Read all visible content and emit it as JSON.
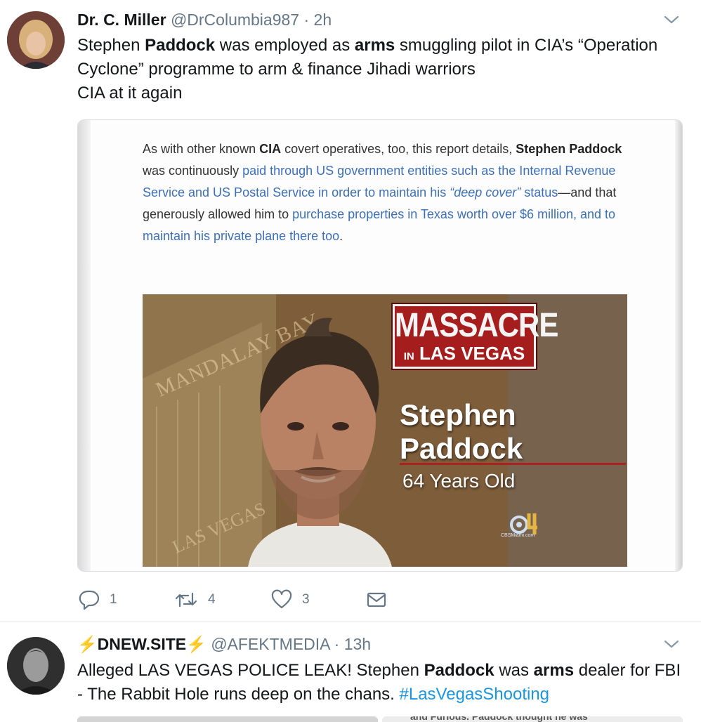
{
  "tweets": [
    {
      "author_name": "Dr. C. Miller",
      "handle": "@DrColumbia987",
      "separator": "·",
      "time": "2h",
      "body": {
        "p1": "Stephen ",
        "b1": "Paddock",
        "p2": " was employed as ",
        "b2": "arms",
        "p3": " smuggling pilot in CIA’s “Operation Cyclone” programme to arm & finance Jihadi warriors",
        "line2": "CIA at it again"
      },
      "card": {
        "article": {
          "t1": "As with other known ",
          "b1": "CIA",
          "t2": " covert operatives, too, this report details, ",
          "b2": "Stephen Paddock",
          "t3": " was continuously ",
          "l1": "paid through US government entities such as the Internal Revenue Service and US Postal Service in order to maintain his ",
          "l1i": "“deep cover”",
          "l1b": " status",
          "t4": "—and that generously allowed him to ",
          "l2": "purchase properties in Texas worth over $6 million, and to maintain his private plane there too",
          "t5": "."
        },
        "photo": {
          "sign": "MANDALAY BAY",
          "lv_sign": "LAS VEGAS",
          "banner_top": "MASSACRE",
          "banner_in": "IN",
          "banner_bottom": "LAS VEGAS",
          "caption_first": "Stephen",
          "caption_last": "Paddock",
          "caption_age": "64 Years Old",
          "station_sub": "CBSMiami.com"
        }
      },
      "actions": {
        "replies": "1",
        "retweets": "4",
        "likes": "3"
      }
    },
    {
      "author_name": "⚡DNEW.SITE⚡",
      "handle": "@AFEKTMEDIA",
      "separator": "·",
      "time": "13h",
      "body": {
        "p1": "Alleged LAS VEGAS POLICE LEAK! Stephen ",
        "b1": "Paddock",
        "p2": " was ",
        "b2": "arms",
        "p3": " dealer for FBI - The Rabbit Hole runs deep on the chans. ",
        "hashtag": "#LasVegasShooting"
      },
      "preview_snippet": "and Furious. Paddock thought he was"
    }
  ],
  "colors": {
    "text": "#14171a",
    "secondary": "#657786",
    "link": "#1b95e0",
    "article_link": "#3d6fb8",
    "banner_red": "#a51d1d"
  },
  "icons": [
    "avatar",
    "caret-down-icon",
    "reply-icon",
    "retweet-icon",
    "like-icon",
    "direct-message-icon"
  ]
}
